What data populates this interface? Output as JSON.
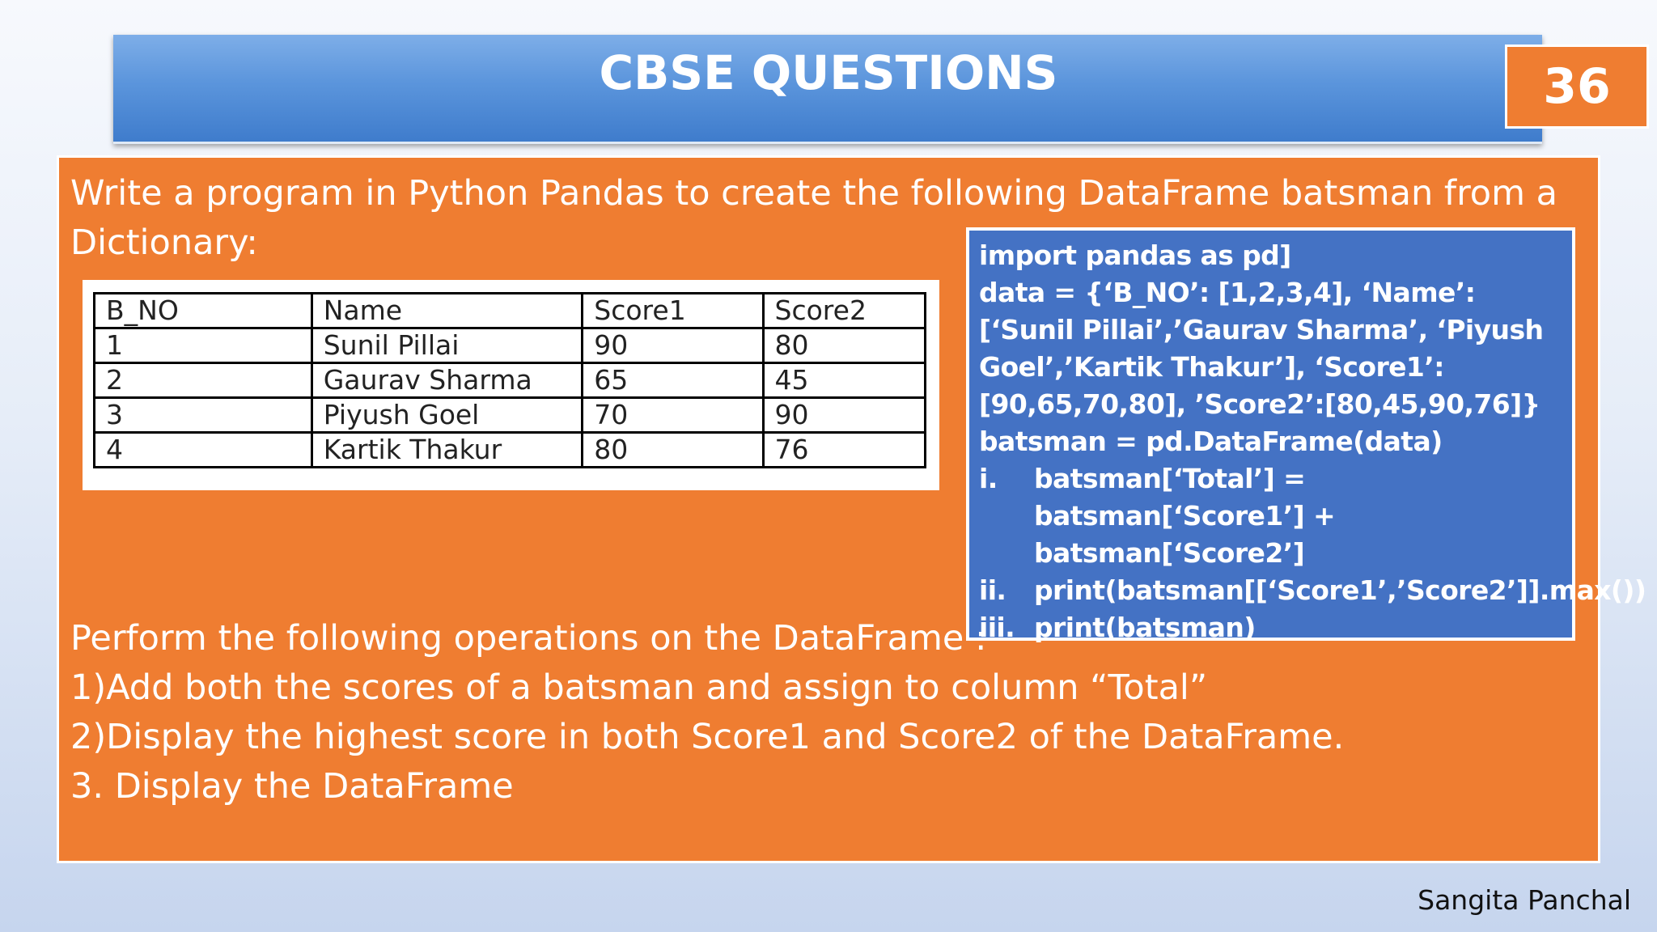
{
  "header": {
    "title": "CBSE QUESTIONS",
    "slide_number": "36"
  },
  "question": {
    "intro": "Write a program in Python Pandas to create the following DataFrame batsman from a Dictionary:"
  },
  "dataframe": {
    "columns": [
      "B_NO",
      "Name",
      "Score1",
      "Score2"
    ],
    "rows": [
      [
        "1",
        "Sunil Pillai",
        "90",
        "80"
      ],
      [
        "2",
        "Gaurav Sharma",
        "65",
        "45"
      ],
      [
        "3",
        "Piyush Goel",
        "70",
        "90"
      ],
      [
        "4",
        "Kartik Thakur",
        "80",
        "76"
      ]
    ]
  },
  "code": {
    "import_line": "import pandas as pd]",
    "data_def": "data = {‘B_NO’: [1,2,3,4], ‘Name’:[‘Sunil Pillai’,’Gaurav Sharma’, ‘Piyush Goel’,’Kartik Thakur’], ‘Score1’:[90,65,70,80], ’Score2’:[80,45,90,76]}",
    "create_line": "batsman = pd.DataFrame(data)",
    "ops": [
      {
        "num": "i.",
        "text": "batsman[‘Total’] = batsman[‘Score1’] + batsman[‘Score2’]"
      },
      {
        "num": "ii.",
        "text": "print(batsman[[‘Score1’,’Score2’]].max())"
      },
      {
        "num": "iii.",
        "text": "print(batsman)"
      }
    ]
  },
  "operations": {
    "heading": "Perform the following operations on the DataFrame :",
    "items": [
      "1)Add both the scores of a batsman and assign to column “Total”",
      "2)Display the highest score in both Score1 and Score2 of the DataFrame.",
      "3. Display the DataFrame"
    ]
  },
  "footer": {
    "author": "Sangita Panchal"
  }
}
